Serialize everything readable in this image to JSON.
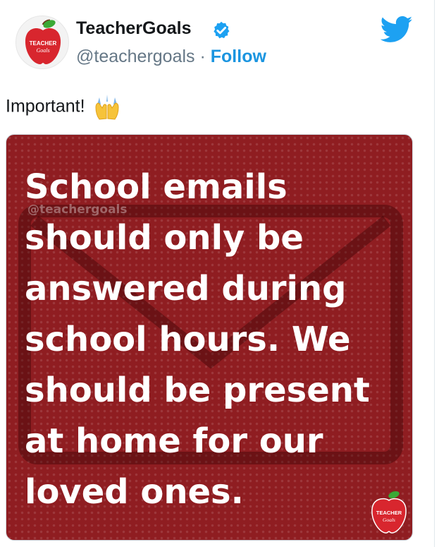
{
  "tweet": {
    "author": {
      "display_name": "TeacherGoals",
      "handle": "@teachergoals",
      "separator": "·",
      "follow_label": "Follow",
      "avatar_logo_text_line1": "TEACHER",
      "avatar_logo_text_line2": "Goals"
    },
    "text": "Important!",
    "emoji": "raised-hands",
    "image": {
      "watermark": "@teachergoals",
      "lines": [
        "School emails",
        "should only be",
        "answered during",
        "school hours. We",
        "should be present",
        "at home for our",
        "loved ones."
      ],
      "logo_text_line1": "TEACHER",
      "logo_text_line2": "Goals"
    }
  },
  "colors": {
    "twitter_blue": "#1da1f2",
    "follow_blue": "#1b95e0",
    "image_red": "#8f1d21",
    "apple_red": "#d8262e"
  },
  "icons": {
    "verified": "verified-badge-icon",
    "twitter": "twitter-bird-icon"
  }
}
